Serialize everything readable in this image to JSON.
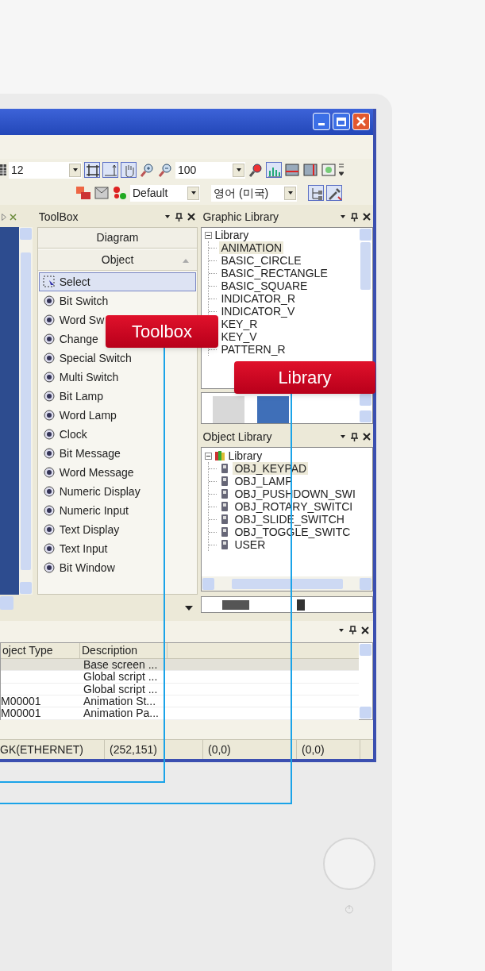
{
  "toolbar_1": {
    "font_size": "12",
    "zoom": "100"
  },
  "toolbar_2": {
    "screen_style": "Default",
    "language": "영어 (미국)"
  },
  "toolbox": {
    "title": "ToolBox",
    "groups": [
      "Diagram",
      "Object"
    ],
    "items": [
      {
        "label": "Select",
        "selected": true
      },
      {
        "label": "Bit Switch",
        "selected": false
      },
      {
        "label": "Word Sw",
        "selected": false
      },
      {
        "label": "Change",
        "selected": false
      },
      {
        "label": "Special Switch",
        "selected": false
      },
      {
        "label": "Multi Switch",
        "selected": false
      },
      {
        "label": "Bit Lamp",
        "selected": false
      },
      {
        "label": "Word Lamp",
        "selected": false
      },
      {
        "label": "Clock",
        "selected": false
      },
      {
        "label": "Bit Message",
        "selected": false
      },
      {
        "label": "Word Message",
        "selected": false
      },
      {
        "label": "Numeric Display",
        "selected": false
      },
      {
        "label": "Numeric Input",
        "selected": false
      },
      {
        "label": "Text Display",
        "selected": false
      },
      {
        "label": "Text Input",
        "selected": false
      },
      {
        "label": "Bit Window",
        "selected": false
      }
    ]
  },
  "graphic_library": {
    "title": "Graphic Library",
    "tree": {
      "label": "Library",
      "expanded": true,
      "children": [
        {
          "label": "ANIMATION",
          "selected": true
        },
        {
          "label": "BASIC_CIRCLE",
          "selected": false
        },
        {
          "label": "BASIC_RECTANGLE",
          "selected": false
        },
        {
          "label": "BASIC_SQUARE",
          "selected": false
        },
        {
          "label": "INDICATOR_R",
          "selected": false
        },
        {
          "label": "INDICATOR_V",
          "selected": false
        },
        {
          "label": "KEY_R",
          "selected": false
        },
        {
          "label": "KEY_V",
          "selected": false
        },
        {
          "label": "PATTERN_R",
          "selected": false
        }
      ]
    }
  },
  "object_library": {
    "title": "Object Library",
    "tree": {
      "label": "Library",
      "expanded": true,
      "children": [
        {
          "label": "OBJ_KEYPAD",
          "selected": true
        },
        {
          "label": "OBJ_LAMP",
          "selected": false
        },
        {
          "label": "OBJ_PUSHDOWN_SWI",
          "selected": false
        },
        {
          "label": "OBJ_ROTARY_SWITCI",
          "selected": false
        },
        {
          "label": "OBJ_SLIDE_SWITCH",
          "selected": false
        },
        {
          "label": "OBJ_TOGGLE_SWITC",
          "selected": false
        },
        {
          "label": "USER",
          "selected": false
        }
      ]
    }
  },
  "output_panel": {
    "columns": [
      "oject Type",
      "Description"
    ],
    "rows": [
      {
        "description": "Base screen ...",
        "selected": true
      },
      {
        "description": "Global script ...",
        "selected": false
      },
      {
        "description": "Global script ...",
        "selected": false
      },
      {
        "column_1": "M00001",
        "description": "Animation St...",
        "selected": false
      },
      {
        "column_1": "M00001",
        "description": "Animation Pa...",
        "selected": false
      }
    ]
  },
  "status_bar": [
    "GK(ETHERNET)",
    "(252,151)",
    "(0,0)",
    "(0,0)"
  ],
  "callouts": [
    {
      "label": "Toolbox"
    },
    {
      "label": "Library"
    }
  ]
}
